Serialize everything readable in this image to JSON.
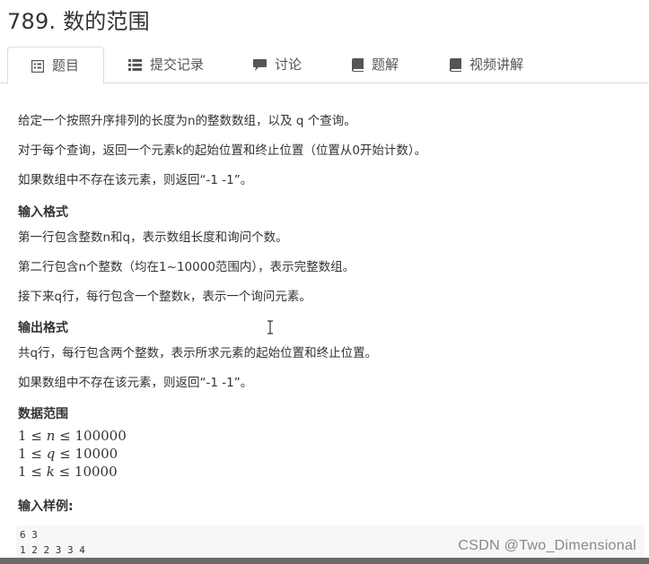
{
  "problem": {
    "title": "789. 数的范围"
  },
  "tabs": [
    {
      "label": "题目",
      "icon": "doc-list-icon",
      "active": true
    },
    {
      "label": "提交记录",
      "icon": "list-icon",
      "active": false
    },
    {
      "label": "讨论",
      "icon": "comment-icon",
      "active": false
    },
    {
      "label": "题解",
      "icon": "book-icon",
      "active": false
    },
    {
      "label": "视频讲解",
      "icon": "book-icon",
      "active": false
    }
  ],
  "description": {
    "p1": "给定一个按照升序排列的长度为n的整数数组，以及 q 个查询。",
    "p2": "对于每个查询，返回一个元素k的起始位置和终止位置（位置从0开始计数）。",
    "p3": "如果数组中不存在该元素，则返回“-1 -1”。"
  },
  "input_format": {
    "heading": "输入格式",
    "lines": [
      "第一行包含整数n和q，表示数组长度和询问个数。",
      "第二行包含n个整数（均在1~10000范围内），表示完整数组。",
      "接下来q行，每行包含一个整数k，表示一个询问元素。"
    ]
  },
  "output_format": {
    "heading": "输出格式",
    "lines": [
      "共q行，每行包含两个整数，表示所求元素的起始位置和终止位置。",
      "如果数组中不存在该元素，则返回“-1 -1”。"
    ]
  },
  "data_range": {
    "heading": "数据范围",
    "rows": [
      {
        "lhs": "1",
        "op": "≤",
        "var": "n",
        "op2": "≤",
        "rhs": "100000"
      },
      {
        "lhs": "1",
        "op": "≤",
        "var": "q",
        "op2": "≤",
        "rhs": "10000"
      },
      {
        "lhs": "1",
        "op": "≤",
        "var": "k",
        "op2": "≤",
        "rhs": "10000"
      }
    ]
  },
  "sample_input": {
    "heading": "输入样例:",
    "lines": [
      "6 3",
      "1 2 2 3 3 4"
    ]
  },
  "watermark": "CSDN @Two_Dimensional",
  "colors": {
    "tab_active_border": "#dddddd",
    "code_bg": "#f7f7f7",
    "bottom_bar": "#6b6b6b"
  }
}
